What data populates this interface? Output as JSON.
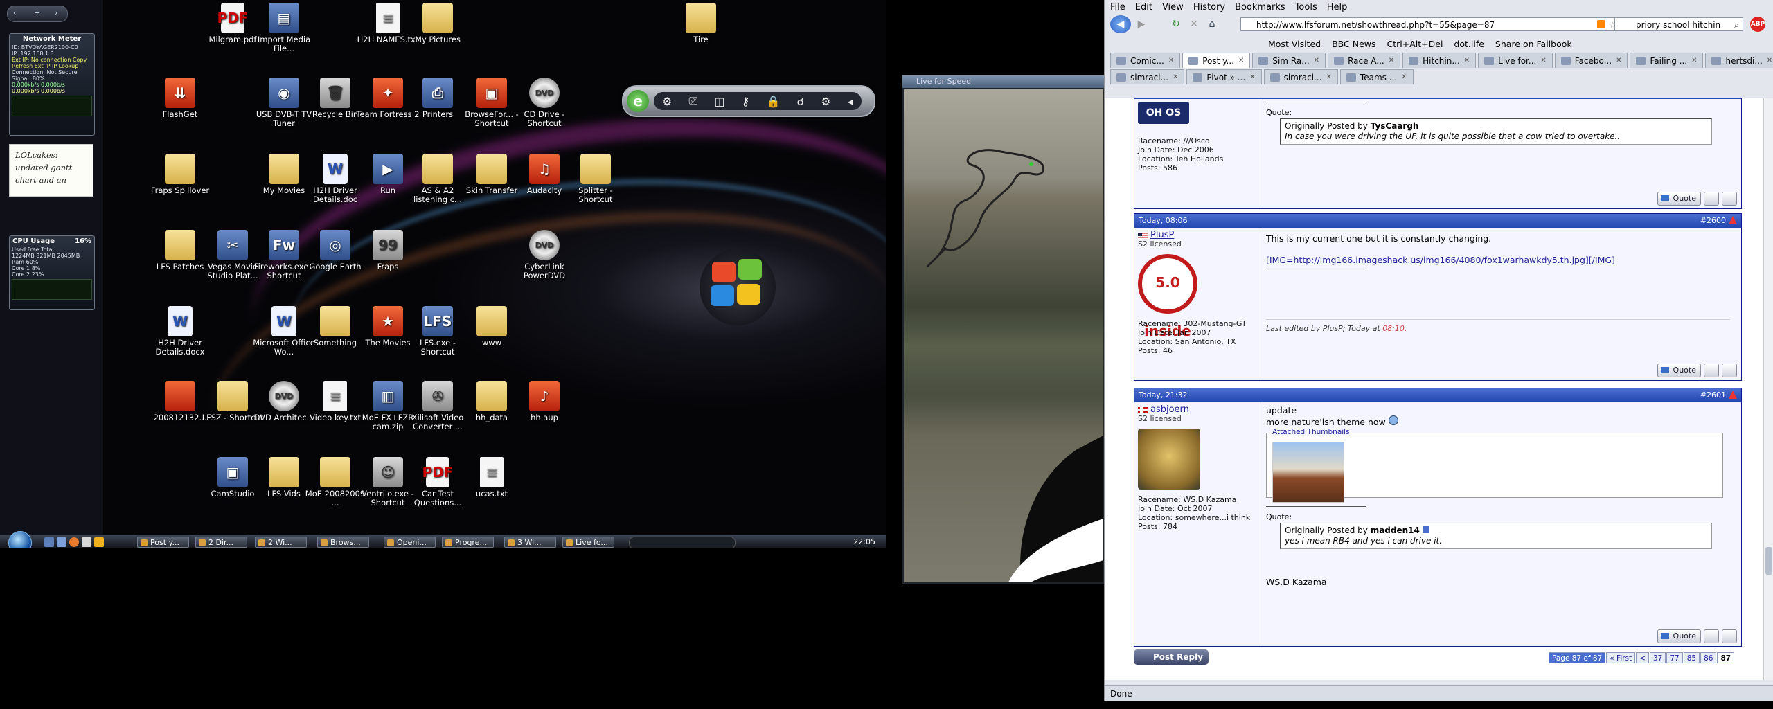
{
  "desktop": {
    "sidebar": {
      "network": {
        "title": "Network Meter",
        "lines": [
          "ID: BTVOYAGER2100-C0",
          "IP: 192.168.1.3",
          "Ext IP: No connection Copy",
          "Refresh Ext IP  IP Lookup",
          "Connection: Not Secure",
          "Signal: 80%",
          "0.000kb/s  0.000b/s",
          "0.000kb/s  0.000b/s"
        ]
      },
      "note": "LOLcakes: updated gantt chart and an",
      "cpu": {
        "title": "CPU Usage",
        "percent": "16%",
        "lines": [
          "Used   Free   Total",
          "1224MB  821MB  2045MB",
          "Ram         60%",
          "Core 1       8%",
          "Core 2      23%"
        ]
      }
    },
    "icons": [
      {
        "label": "Milgram.pdf",
        "type": "pdf",
        "glyph": "PDF"
      },
      {
        "label": "Import Media File...",
        "type": "app",
        "glyph": "▤"
      },
      {
        "label": "H2H NAMES.txt",
        "type": "doc",
        "glyph": "≡"
      },
      {
        "label": "My Pictures",
        "type": "folder",
        "glyph": ""
      },
      {
        "label": "Tire",
        "type": "folder",
        "glyph": ""
      },
      {
        "label": "FlashGet",
        "type": "red",
        "glyph": "⇊"
      },
      {
        "label": "USB DVB-T TV Tuner",
        "type": "app",
        "glyph": "◉"
      },
      {
        "label": "Recycle Bin",
        "type": "grey",
        "glyph": "🗑"
      },
      {
        "label": "Team Fortress 2",
        "type": "red",
        "glyph": "✦"
      },
      {
        "label": "Printers",
        "type": "app",
        "glyph": "⎙"
      },
      {
        "label": "BrowseFor... - Shortcut",
        "type": "red",
        "glyph": "▣"
      },
      {
        "label": "CD Drive - Shortcut",
        "type": "disc",
        "glyph": "DVD"
      },
      {
        "label": "Fraps Spillover",
        "type": "folder",
        "glyph": ""
      },
      {
        "label": "My Movies",
        "type": "folder",
        "glyph": ""
      },
      {
        "label": "H2H Driver Details.doc",
        "type": "word",
        "glyph": "W"
      },
      {
        "label": "Run",
        "type": "app",
        "glyph": "▶"
      },
      {
        "label": "AS & A2 listening c...",
        "type": "folder",
        "glyph": ""
      },
      {
        "label": "Skin Transfer",
        "type": "folder",
        "glyph": ""
      },
      {
        "label": "Audacity",
        "type": "red",
        "glyph": "♫"
      },
      {
        "label": "Splitter - Shortcut",
        "type": "folder",
        "glyph": ""
      },
      {
        "label": "LFS Patches",
        "type": "folder",
        "glyph": ""
      },
      {
        "label": "Vegas Movie Studio Plat...",
        "type": "app",
        "glyph": "✂"
      },
      {
        "label": "Fireworks.exe - Shortcut",
        "type": "app",
        "glyph": "Fw"
      },
      {
        "label": "Google Earth",
        "type": "app",
        "glyph": "◎"
      },
      {
        "label": "Fraps",
        "type": "grey",
        "glyph": "99"
      },
      {
        "label": "CyberLink PowerDVD",
        "type": "disc",
        "glyph": "DVD"
      },
      {
        "label": "H2H Driver Details.docx",
        "type": "word",
        "glyph": "W"
      },
      {
        "label": "Microsoft Office Wo...",
        "type": "word",
        "glyph": "W"
      },
      {
        "label": "Something",
        "type": "folder",
        "glyph": ""
      },
      {
        "label": "The Movies",
        "type": "red",
        "glyph": "★"
      },
      {
        "label": "LFS.exe - Shortcut",
        "type": "app",
        "glyph": "LFS"
      },
      {
        "label": "www",
        "type": "folder",
        "glyph": ""
      },
      {
        "label": "200812132...",
        "type": "red",
        "glyph": ""
      },
      {
        "label": "LFSZ - Shortcut",
        "type": "folder",
        "glyph": ""
      },
      {
        "label": "DVD Architec...",
        "type": "disc",
        "glyph": "DVD"
      },
      {
        "label": "Video key.txt",
        "type": "doc",
        "glyph": "≡"
      },
      {
        "label": "MoE FX+FZR cam.zip",
        "type": "app",
        "glyph": "▥"
      },
      {
        "label": "Xilisoft Video Converter ...",
        "type": "grey",
        "glyph": "✇"
      },
      {
        "label": "hh_data",
        "type": "folder",
        "glyph": ""
      },
      {
        "label": "hh.aup",
        "type": "red",
        "glyph": "♪"
      },
      {
        "label": "CamStudio",
        "type": "app",
        "glyph": "▣"
      },
      {
        "label": "LFS Vids",
        "type": "folder",
        "glyph": ""
      },
      {
        "label": "MoE 20082009 ...",
        "type": "folder",
        "glyph": ""
      },
      {
        "label": "Ventrilo.exe - Shortcut",
        "type": "grey",
        "glyph": "☺"
      },
      {
        "label": "Car Test Questions...",
        "type": "pdf",
        "glyph": "PDF"
      },
      {
        "label": "ucas.txt",
        "type": "doc",
        "glyph": "≡"
      }
    ],
    "dock_icons": [
      "⚙",
      "⎚",
      "◫",
      "⚷",
      "🔒",
      "☌",
      "⚙",
      "◂"
    ],
    "taskbar": {
      "buttons": [
        "Post y...",
        "2 Dir...",
        "2 Wi...",
        "Brows...",
        "Openi...",
        "Progre...",
        "3 Wi...",
        "Live fo..."
      ],
      "clock": "22:05"
    }
  },
  "lfs_window": {
    "title": "Live for Speed"
  },
  "browser": {
    "menu": [
      "File",
      "Edit",
      "View",
      "History",
      "Bookmarks",
      "Tools",
      "Help"
    ],
    "url": "http://www.lfsforum.net/showthread.php?t=55&page=87",
    "search_value": "priory school hitchin",
    "bookmarks": [
      "Most Visited",
      "BBC News",
      "Ctrl+Alt+Del",
      "dot.life",
      "Share on Failbook"
    ],
    "tabs_row1": [
      "Comic...",
      "Post y...",
      "Sim Ra...",
      "Race A...",
      "Hitchin...",
      "Live for...",
      "Facebo...",
      "Failing ...",
      "hertsdi..."
    ],
    "tabs_row2": [
      "simraci...",
      "Pivot » ...",
      "simraci...",
      "Teams ..."
    ],
    "posts": [
      {
        "header_date": "",
        "number": "",
        "user": "",
        "user_lines": [
          "Racename: ///Osco",
          "Join Date: Dec 2006",
          "Location: Teh Hollands",
          "Posts: 586"
        ],
        "avatar_text": "OH OS",
        "quote_label": "Quote:",
        "quote_by": "Originally Posted by",
        "quote_author": "TysCaargh",
        "quote_text": "In case you were driving the UF, it is quite possible that a cow tried to overtake.."
      },
      {
        "header_date": "Today, 08:06",
        "number": "#2600",
        "user": "PlusP",
        "user_title": "S2 licensed",
        "user_lines": [
          "Racename: 302-Mustang-GT",
          "Join Date: Jan 2007",
          "Location: San Antonio, TX",
          "Posts: 46"
        ],
        "avatar_text": "5.0 inside",
        "text": "This is my current one but it is constantly changing.",
        "link": "[IMG=http://img166.imageshack.us/img166/4080/fox1warhawkdy5.th.jpg][/IMG]",
        "edited": "Last edited by PlusP; Today at",
        "edited_time": "08:10."
      },
      {
        "header_date": "Today, 21:32",
        "number": "#2601",
        "user": "asbjoern",
        "user_title": "S2 licensed",
        "user_lines": [
          "Racename: WS.D Kazama",
          "Join Date: Oct 2007",
          "Location: somewhere...i think",
          "Posts: 784"
        ],
        "text1": "update",
        "text2": "more nature'ish theme now",
        "attach_label": "Attached Thumbnails",
        "quote_label": "Quote:",
        "quote_by": "Originally Posted by",
        "quote_author": "madden14",
        "quote_text": "yes i mean RB4 and yes i can drive it.",
        "signature": "WS.D Kazama"
      }
    ],
    "quote_button": "Quote",
    "post_reply": "Post Reply",
    "pagenav": [
      "Page 87 of 87",
      "« First",
      "<",
      "37",
      "77",
      "85",
      "86",
      "87"
    ],
    "status": "Done"
  }
}
